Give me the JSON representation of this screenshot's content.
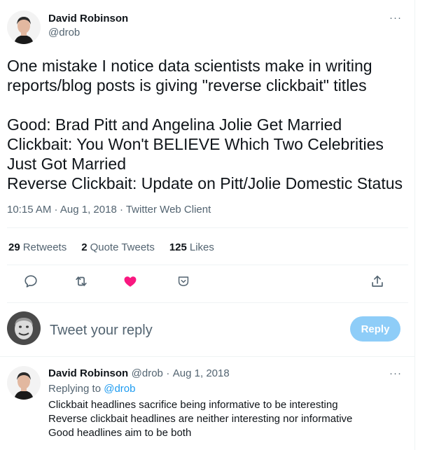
{
  "tweet": {
    "author_name": "David Robinson",
    "author_handle": "@drob",
    "more_label": "···",
    "text": "One mistake I notice data scientists make in writing reports/blog posts is giving \"reverse clickbait\" titles\n\nGood: Brad Pitt and Angelina Jolie Get Married\nClickbait: You Won't BELIEVE Which Two Celebrities Just Got Married\nReverse Clickbait: Update on Pitt/Jolie Domestic Status",
    "timestamp": "10:15 AM · Aug 1, 2018 · Twitter Web Client"
  },
  "stats": {
    "retweets_count": "29",
    "retweets_label": "Retweets",
    "quotes_count": "2",
    "quotes_label": "Quote Tweets",
    "likes_count": "125",
    "likes_label": "Likes"
  },
  "actions": {
    "icons": [
      "reply-icon",
      "retweet-icon",
      "like-icon",
      "share-icon",
      "upload-icon"
    ],
    "like_color": "#f91880"
  },
  "composer": {
    "placeholder": "Tweet your reply",
    "button_label": "Reply",
    "button_color": "#8ecdf8"
  },
  "reply": {
    "author_name": "David Robinson",
    "author_handle": "@drob",
    "separator": "·",
    "date": "Aug 1, 2018",
    "more_label": "···",
    "replying_to_label": "Replying to",
    "replying_to_handle": "@drob",
    "text": "Clickbait headlines sacrifice being informative to be interesting\nReverse clickbait headlines are neither interesting nor informative\nGood headlines aim to be both"
  },
  "colors": {
    "accent": "#1d9bf0",
    "secondary_text": "#536471",
    "divider": "#eff3f4"
  }
}
